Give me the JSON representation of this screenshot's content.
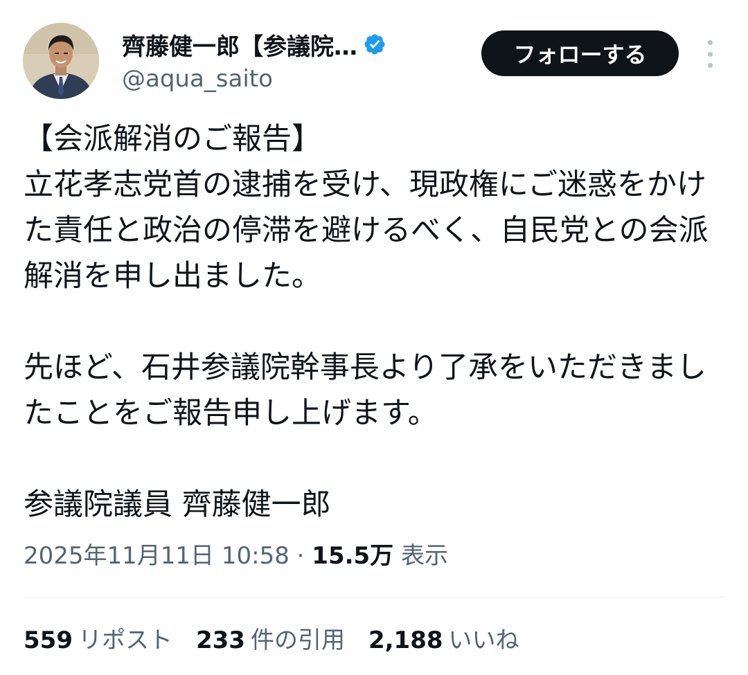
{
  "author": {
    "display_name": "齊藤健一郎【参議院…",
    "handle": "@aqua_saito",
    "verified": true,
    "verified_icon": "verified-badge-icon",
    "verified_color": "#1d9bf0"
  },
  "follow_button": {
    "label": "フォローする"
  },
  "more_menu": {
    "icon": "more-vertical-icon"
  },
  "tweet": {
    "paragraphs": [
      "【会派解消のご報告】\n立花孝志党首の逮捕を受け、現政権にご迷惑をかけた責任と政治の停滞を避けるべく、自民党との会派解消を申し出ました。",
      "先ほど、石井参議院幹事長より了承をいただきましたことをご報告申し上げます。",
      "参議院議員 齊藤健一郎"
    ]
  },
  "meta": {
    "timestamp": "2025年11月11日 10:58",
    "separator": "·",
    "views_count": "15.5万",
    "views_label": "表示"
  },
  "stats": {
    "reposts_count": "559",
    "reposts_label": "リポスト",
    "quotes_count": "233",
    "quotes_label": "件の引用",
    "likes_count": "2,188",
    "likes_label": "いいね"
  },
  "colors": {
    "text_primary": "#0f1419",
    "text_secondary": "#536471",
    "button_bg": "#0f1419",
    "divider": "#e4e8eb"
  }
}
